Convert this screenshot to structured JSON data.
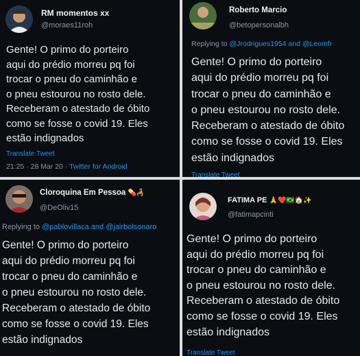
{
  "tweets": [
    {
      "name": "RM momentos xx",
      "handle": "@moraes11roh",
      "body": "Gente! O primo do porteiro\naqui do prédio morreu pq foi\ntrocar o pneu do caminhão e\no pneu estourou no rosto dele.\nReceberam o atestado de óbito\ncomo se fosse o covid 19. Eles\nestão indignados",
      "translate": "Translate Tweet",
      "timestamp": "21:25 · 28 Mar 20 · ",
      "source": "Twitter for Android"
    },
    {
      "name": "Roberto Marcio",
      "handle": "@betopersonalbh",
      "reply_prefix": "Replying to ",
      "reply_to": "@Jrodrigues1954 and @Leomfr",
      "body": "Gente! O primo do porteiro\naqui do prédio morreu pq foi\ntrocar o pneu do caminhão e\no pneu estourou no rosto dele.\nReceberam o atestado de óbito\ncomo se fosse o covid 19. Eles\nestão indignados",
      "translate": "Translate Tweet"
    },
    {
      "name": "Cloroquina Em Pessoa",
      "name_emoji": "💊🦂",
      "handle": "@DeOliv15",
      "reply_prefix": "Replying to ",
      "reply_to": "@pablovillaca and @jairbolsonaro",
      "body": "Gente! O primo do porteiro\naqui do prédio morreu pq foi\ntrocar o pneu do caminhão e\no pneu estourou no rosto dele.\nReceberam o atestado de óbito\ncomo se fosse o covid 19. Eles\nestão indignados"
    },
    {
      "name": "FATIMA PE",
      "name_emoji": "🙏❤️🇧🇷🏠✨",
      "handle": "@fatimapcinti",
      "body": "Gente! O primo do porteiro\naqui do prédio morreu pq foi\ntrocar o pneu do caminhão e\no pneu estourou no rosto dele.\nReceberam o atestado de óbito\ncomo se fosse o covid 19. Eles\nestão indignados",
      "translate": "Translate Tweet"
    }
  ],
  "colors": {
    "background": "#0a0d12",
    "text": "#e7e9ea",
    "muted": "#8b98a5",
    "link": "#1d9bf0",
    "separator": "#dcdcdc"
  }
}
